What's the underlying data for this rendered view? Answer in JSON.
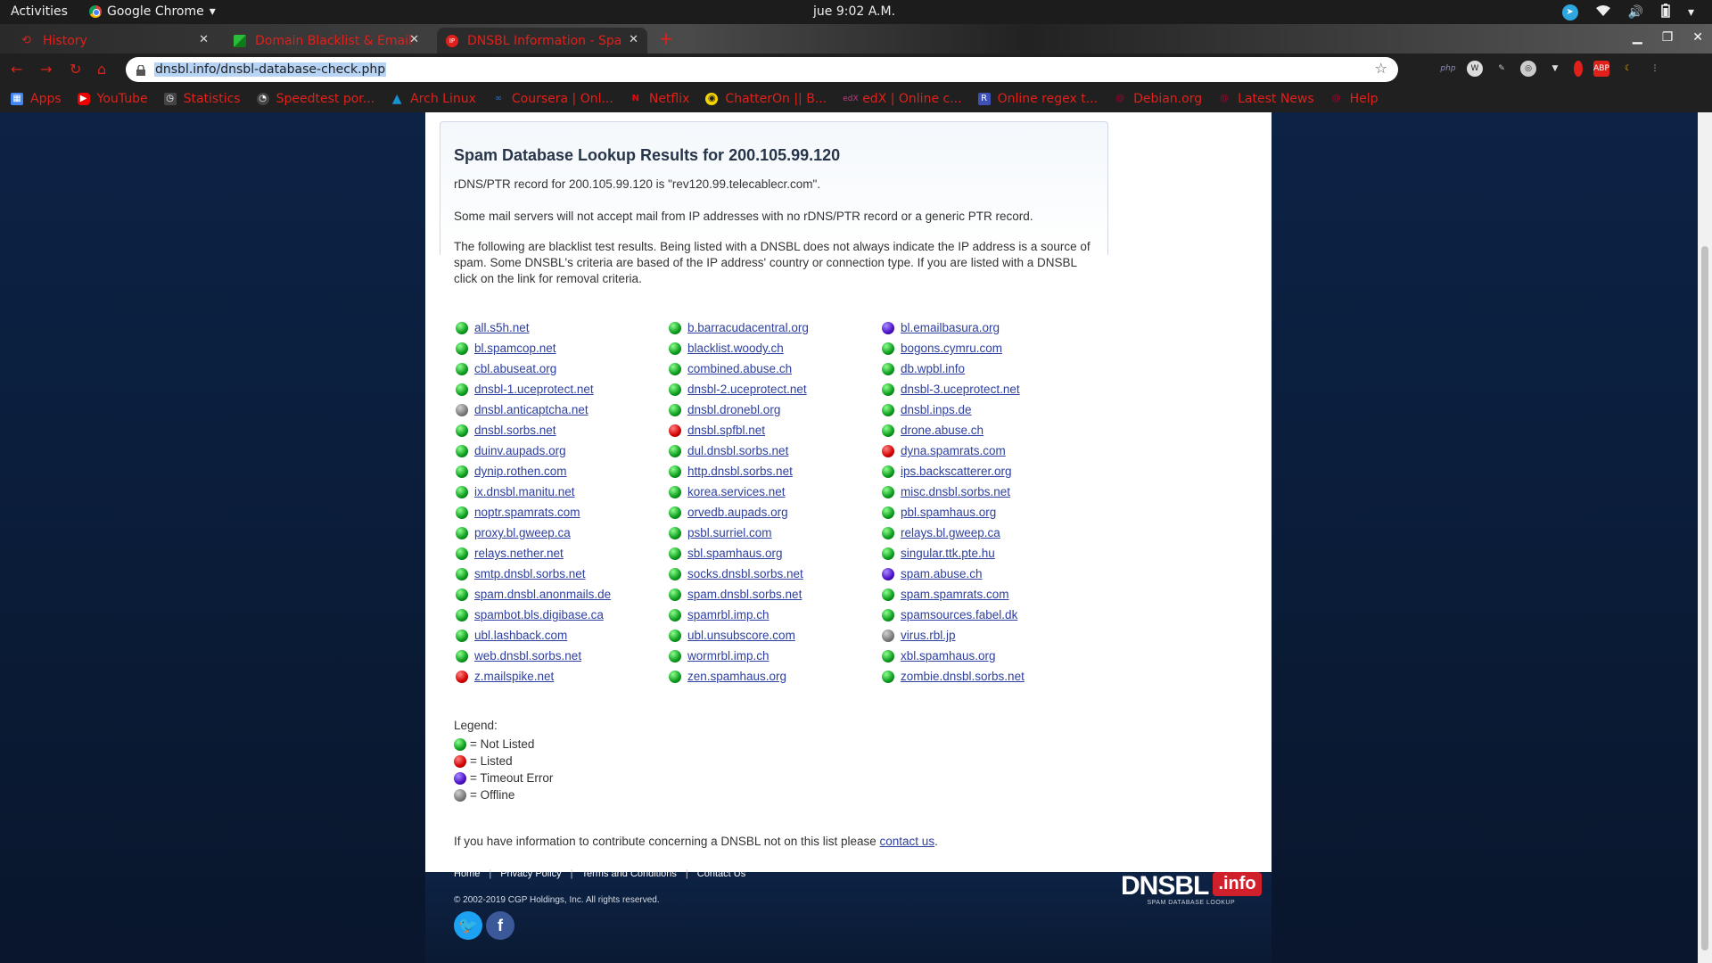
{
  "topbar": {
    "activities": "Activities",
    "app_name": "Google Chrome",
    "clock": "jue  9:02 A.M."
  },
  "tabs": [
    {
      "title": "History",
      "icon": "history-icon"
    },
    {
      "title": "Domain Blacklist & Email",
      "icon": "domain-favicon"
    },
    {
      "title": "DNSBL Information - Spa",
      "icon": "ip-favicon"
    }
  ],
  "toolbar": {
    "url": "dnsbl.info/dnsbl-database-check.php"
  },
  "bookmarks": [
    {
      "label": "Apps",
      "icon": "apps-grid-icon",
      "color": "#4285f4"
    },
    {
      "label": "YouTube",
      "icon": "youtube-icon",
      "color": "#e00"
    },
    {
      "label": "Statistics",
      "icon": "statistics-icon",
      "color": "#555"
    },
    {
      "label": "Speedtest por...",
      "icon": "speedtest-icon",
      "color": "#555"
    },
    {
      "label": "Arch Linux",
      "icon": "arch-icon",
      "color": "#1793d1"
    },
    {
      "label": "Coursera | Onl...",
      "icon": "coursera-icon",
      "color": "#2a73cc"
    },
    {
      "label": "Netflix",
      "icon": "netflix-icon",
      "color": "#e50914"
    },
    {
      "label": "ChatterOn || B...",
      "icon": "chatteron-icon",
      "color": "#f5d400"
    },
    {
      "label": "edX | Online c...",
      "icon": "edx-icon",
      "color": "#02262b"
    },
    {
      "label": "Online regex t...",
      "icon": "regex-icon",
      "color": "#3f51b5"
    },
    {
      "label": "Debian.org",
      "icon": "debian-icon",
      "color": "#a80030"
    },
    {
      "label": "Latest News",
      "icon": "news-icon",
      "color": "#a80030"
    },
    {
      "label": "Help",
      "icon": "help-icon",
      "color": "#a80030"
    }
  ],
  "page": {
    "title": "Spam Database Lookup Results for 200.105.99.120",
    "ptr_text": "rDNS/PTR record for 200.105.99.120 is \"rev120.99.telecablecr.com\".",
    "mail_note": "Some mail servers will not accept mail from IP addresses with no rDNS/PTR record or a generic PTR record.",
    "explanation": "The following are blacklist test results. Being listed with a DNSBL does not always indicate the IP address is a source of spam. Some DNSBL's criteria are based of the IP address' country or connection type. If you are listed with a DNSBL click on the link for removal criteria.",
    "contribute_text": "If you have information to contribute concerning a DNSBL not on this list please ",
    "contact_link": "contact us",
    "contribute_end": "."
  },
  "dnsbl_columns": [
    [
      {
        "name": "all.s5h.net",
        "status": "ok"
      },
      {
        "name": "bl.spamcop.net",
        "status": "ok"
      },
      {
        "name": "cbl.abuseat.org",
        "status": "ok"
      },
      {
        "name": "dnsbl-1.uceprotect.net",
        "status": "ok"
      },
      {
        "name": "dnsbl.anticaptcha.net",
        "status": "offline"
      },
      {
        "name": "dnsbl.sorbs.net",
        "status": "ok"
      },
      {
        "name": "duinv.aupads.org",
        "status": "ok"
      },
      {
        "name": "dynip.rothen.com",
        "status": "ok"
      },
      {
        "name": "ix.dnsbl.manitu.net",
        "status": "ok"
      },
      {
        "name": "noptr.spamrats.com",
        "status": "ok"
      },
      {
        "name": "proxy.bl.gweep.ca",
        "status": "ok"
      },
      {
        "name": "relays.nether.net",
        "status": "ok"
      },
      {
        "name": "smtp.dnsbl.sorbs.net",
        "status": "ok"
      },
      {
        "name": "spam.dnsbl.anonmails.de",
        "status": "ok"
      },
      {
        "name": "spambot.bls.digibase.ca",
        "status": "ok"
      },
      {
        "name": "ubl.lashback.com",
        "status": "ok"
      },
      {
        "name": "web.dnsbl.sorbs.net",
        "status": "ok"
      },
      {
        "name": "z.mailspike.net",
        "status": "listed"
      }
    ],
    [
      {
        "name": "b.barracudacentral.org",
        "status": "ok"
      },
      {
        "name": "blacklist.woody.ch",
        "status": "ok"
      },
      {
        "name": "combined.abuse.ch",
        "status": "ok"
      },
      {
        "name": "dnsbl-2.uceprotect.net",
        "status": "ok"
      },
      {
        "name": "dnsbl.dronebl.org",
        "status": "ok"
      },
      {
        "name": "dnsbl.spfbl.net",
        "status": "listed"
      },
      {
        "name": "dul.dnsbl.sorbs.net",
        "status": "ok"
      },
      {
        "name": "http.dnsbl.sorbs.net",
        "status": "ok"
      },
      {
        "name": "korea.services.net",
        "status": "ok"
      },
      {
        "name": "orvedb.aupads.org",
        "status": "ok"
      },
      {
        "name": "psbl.surriel.com",
        "status": "ok"
      },
      {
        "name": "sbl.spamhaus.org",
        "status": "ok"
      },
      {
        "name": "socks.dnsbl.sorbs.net",
        "status": "ok"
      },
      {
        "name": "spam.dnsbl.sorbs.net",
        "status": "ok"
      },
      {
        "name": "spamrbl.imp.ch",
        "status": "ok"
      },
      {
        "name": "ubl.unsubscore.com",
        "status": "ok"
      },
      {
        "name": "wormrbl.imp.ch",
        "status": "ok"
      },
      {
        "name": "zen.spamhaus.org",
        "status": "ok"
      }
    ],
    [
      {
        "name": "bl.emailbasura.org",
        "status": "timeout"
      },
      {
        "name": "bogons.cymru.com",
        "status": "ok"
      },
      {
        "name": "db.wpbl.info",
        "status": "ok"
      },
      {
        "name": "dnsbl-3.uceprotect.net",
        "status": "ok"
      },
      {
        "name": "dnsbl.inps.de",
        "status": "ok"
      },
      {
        "name": "drone.abuse.ch",
        "status": "ok"
      },
      {
        "name": "dyna.spamrats.com",
        "status": "listed"
      },
      {
        "name": "ips.backscatterer.org",
        "status": "ok"
      },
      {
        "name": "misc.dnsbl.sorbs.net",
        "status": "ok"
      },
      {
        "name": "pbl.spamhaus.org",
        "status": "ok"
      },
      {
        "name": "relays.bl.gweep.ca",
        "status": "ok"
      },
      {
        "name": "singular.ttk.pte.hu",
        "status": "ok"
      },
      {
        "name": "spam.abuse.ch",
        "status": "timeout"
      },
      {
        "name": "spam.spamrats.com",
        "status": "ok"
      },
      {
        "name": "spamsources.fabel.dk",
        "status": "ok"
      },
      {
        "name": "virus.rbl.jp",
        "status": "offline"
      },
      {
        "name": "xbl.spamhaus.org",
        "status": "ok"
      },
      {
        "name": "zombie.dnsbl.sorbs.net",
        "status": "ok"
      }
    ]
  ],
  "legend": {
    "title": "Legend:",
    "items": [
      {
        "status": "ok",
        "label": "= Not Listed"
      },
      {
        "status": "listed",
        "label": "= Listed"
      },
      {
        "status": "timeout",
        "label": "= Timeout Error"
      },
      {
        "status": "offline",
        "label": "= Offline"
      }
    ]
  },
  "footer": {
    "links": [
      "Home",
      "Privacy Policy",
      "Terms and Conditions",
      "Contact Us"
    ],
    "copyright": "© 2002-2019 CGP Holdings, Inc. All rights reserved.",
    "logo_main": "DNSBL",
    "logo_badge": ".info",
    "logo_tagline": "SPAM DATABASE LOOKUP"
  },
  "colors": {
    "link": "#2d3fa0",
    "tab_text": "#e0201a",
    "ok": "#0c9c1e",
    "listed": "#d30000",
    "timeout": "#4a10c8",
    "offline": "#7a7a7a"
  }
}
